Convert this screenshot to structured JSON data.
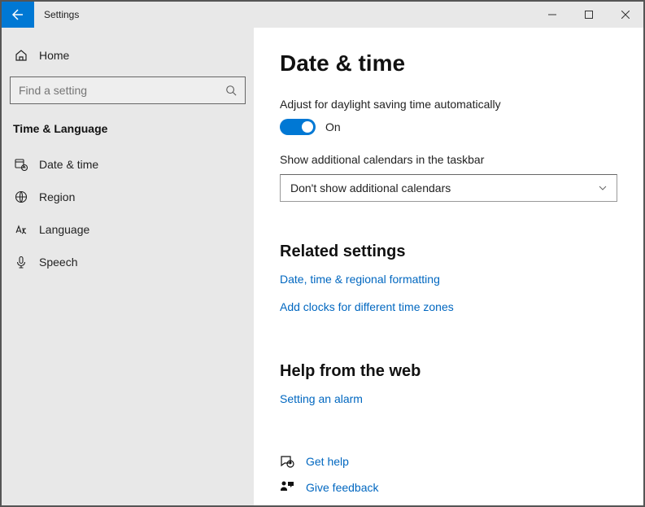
{
  "titlebar": {
    "app_title": "Settings"
  },
  "sidebar": {
    "home_label": "Home",
    "search_placeholder": "Find a setting",
    "section_label": "Time & Language",
    "items": [
      {
        "label": "Date & time"
      },
      {
        "label": "Region"
      },
      {
        "label": "Language"
      },
      {
        "label": "Speech"
      }
    ]
  },
  "main": {
    "page_title": "Date & time",
    "dst_label": "Adjust for daylight saving time automatically",
    "dst_state": "On",
    "calendar_label": "Show additional calendars in the taskbar",
    "calendar_value": "Don't show additional calendars",
    "related_heading": "Related settings",
    "related_links": [
      "Date, time & regional formatting",
      "Add clocks for different time zones"
    ],
    "help_heading": "Help from the web",
    "help_links": [
      "Setting an alarm"
    ],
    "footer": {
      "get_help": "Get help",
      "give_feedback": "Give feedback"
    }
  }
}
